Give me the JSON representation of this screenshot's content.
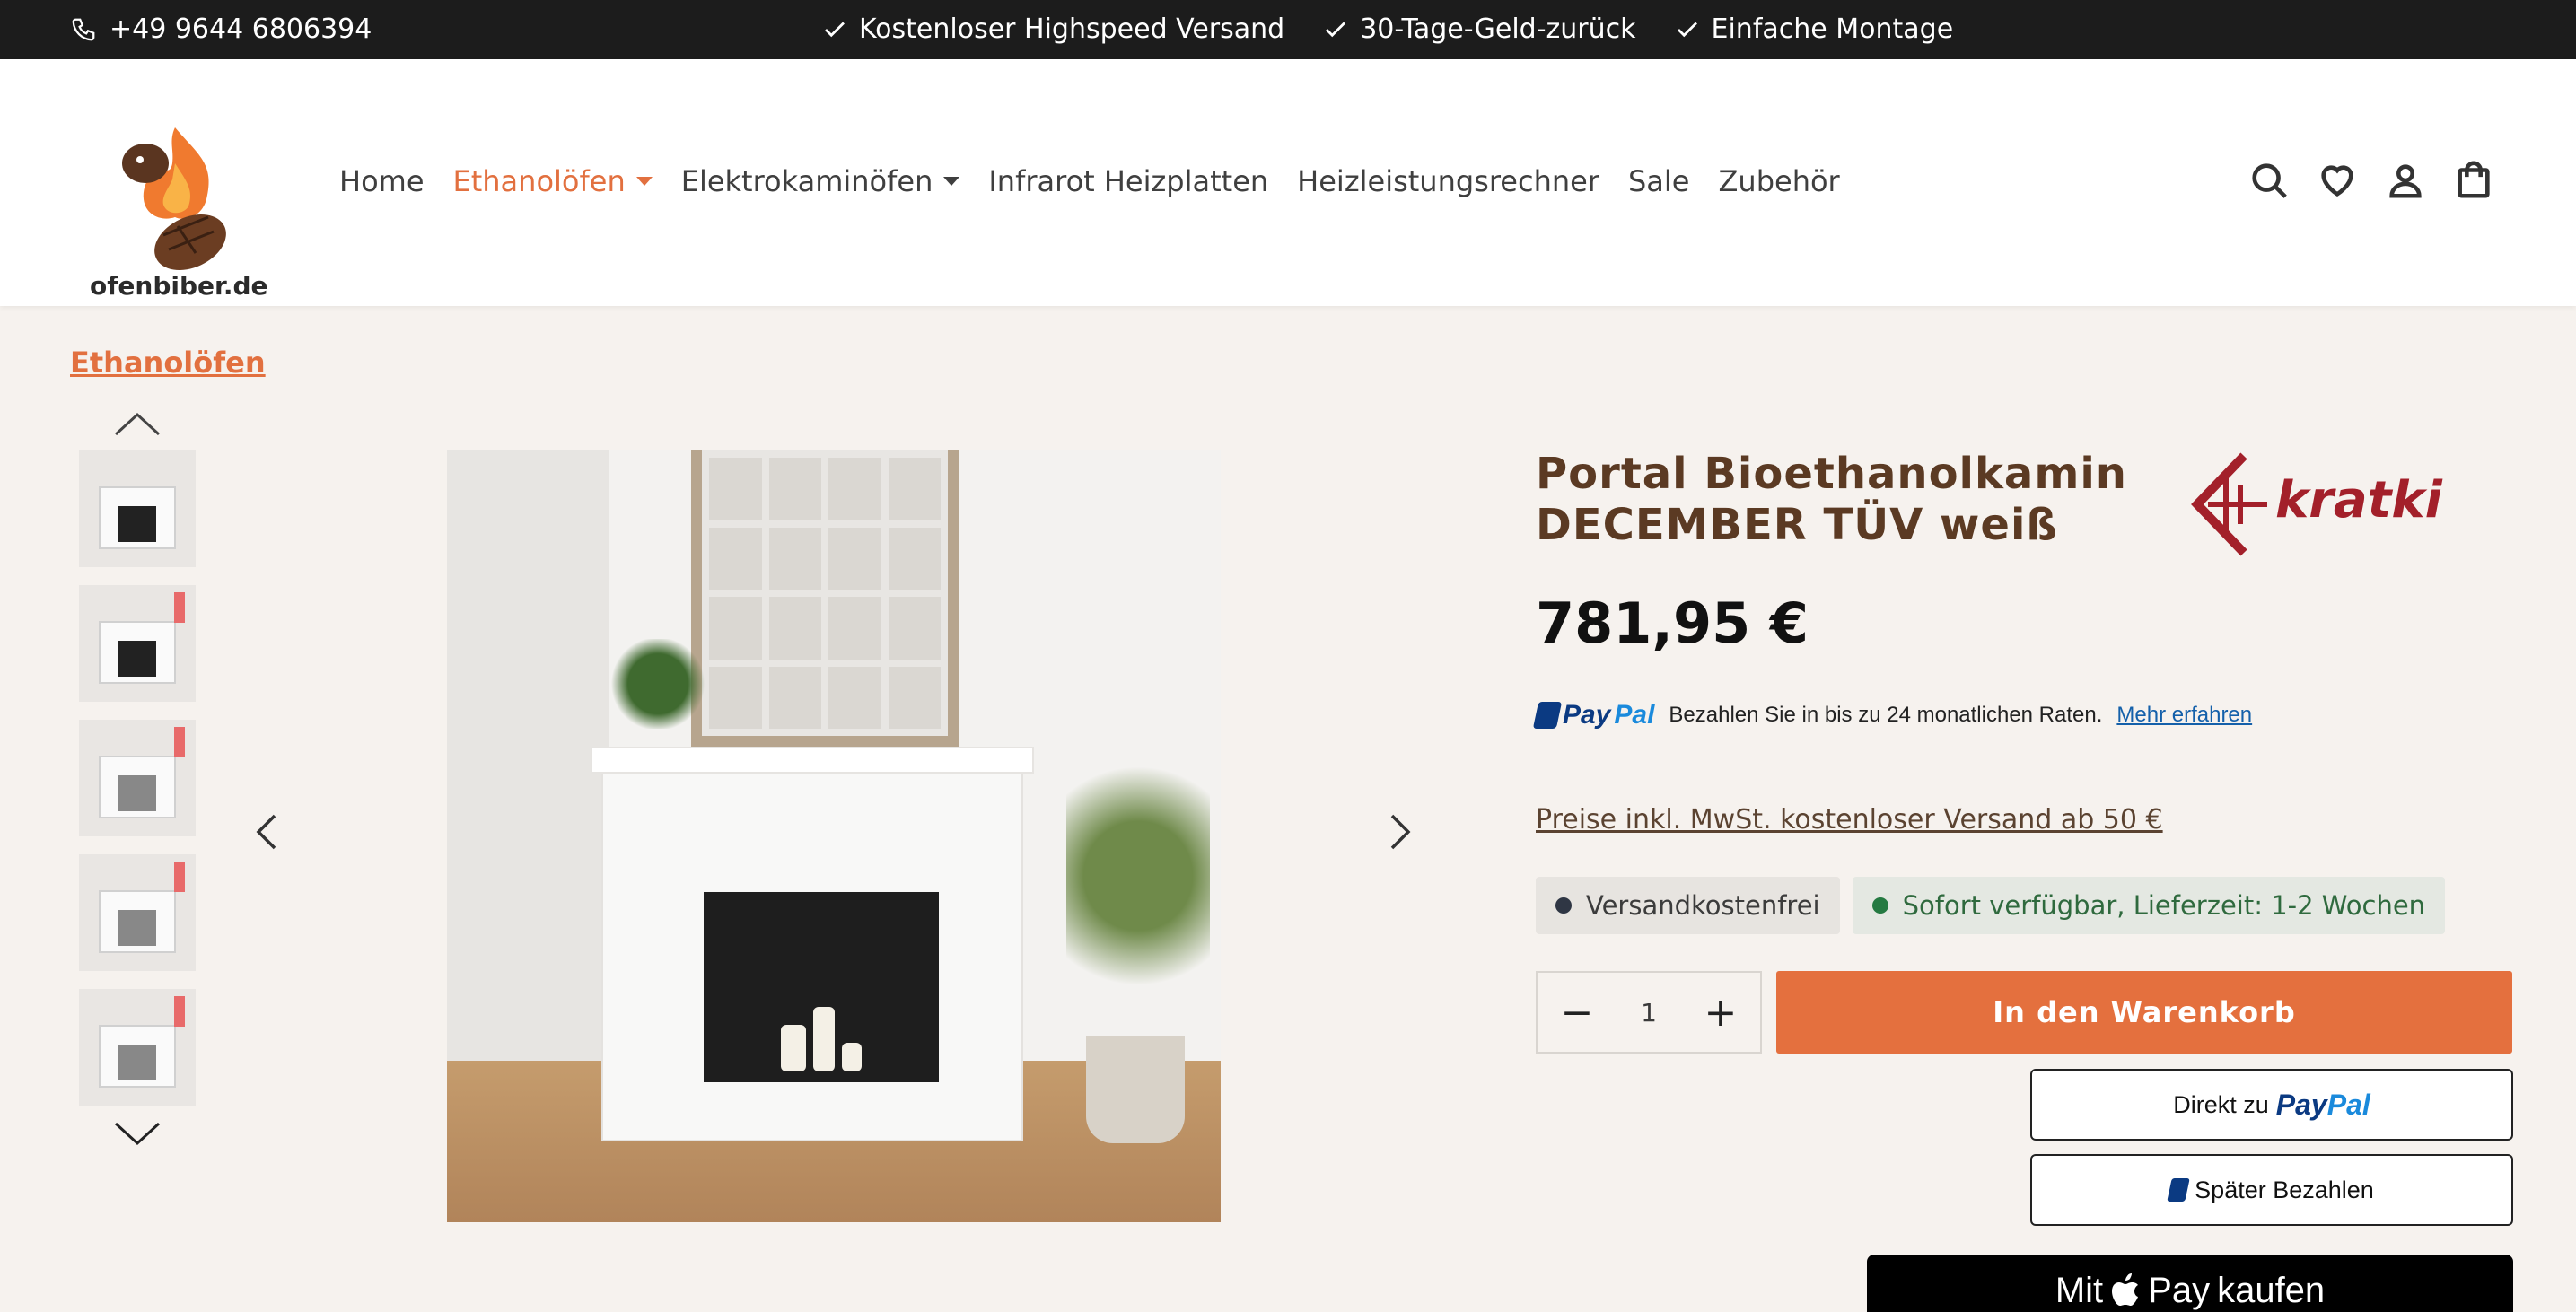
{
  "topbar": {
    "phone": "+49 9644 6806394",
    "usps": [
      "Kostenloser Highspeed Versand",
      "30-Tage-Geld-zurück",
      "Einfache Montage"
    ]
  },
  "header": {
    "logo_text": "ofenbiber.de",
    "nav": [
      {
        "label": "Home",
        "has_dropdown": false,
        "active": false
      },
      {
        "label": "Ethanolöfen",
        "has_dropdown": true,
        "active": true
      },
      {
        "label": "Elektrokaminöfen",
        "has_dropdown": true,
        "active": false
      },
      {
        "label": "Infrarot Heizplatten",
        "has_dropdown": false,
        "active": false
      },
      {
        "label": "Heizleistungsrechner",
        "has_dropdown": false,
        "active": false
      },
      {
        "label": "Sale",
        "has_dropdown": false,
        "active": false
      },
      {
        "label": "Zubehör",
        "has_dropdown": false,
        "active": false
      }
    ],
    "icons": [
      "search-icon",
      "wishlist-heart-icon",
      "account-icon",
      "cart-bag-icon"
    ]
  },
  "breadcrumb": "Ethanolöfen",
  "gallery": {
    "thumbnail_count": 5
  },
  "product": {
    "title": "Portal Bioethanolkamin DECEMBER TÜV weiß",
    "brand": "kratki",
    "price": "781,95 €",
    "paypal": {
      "logo_pay": "Pay",
      "logo_pal": "Pal",
      "text": "Bezahlen Sie in bis zu 24 monatlichen Raten.",
      "link": "Mehr erfahren"
    },
    "tax_note": "Preise inkl. MwSt. kostenloser Versand ab 50 €",
    "badges": [
      "Versandkostenfrei",
      "Sofort verfügbar, Lieferzeit: 1-2 Wochen"
    ],
    "quantity": "1",
    "add_to_cart": "In den Warenkorb",
    "paypal_direct_prefix": "Direkt zu",
    "paypal_word_pay": "Pay",
    "paypal_word_pal": "Pal",
    "paypal_later": "Später Bezahlen",
    "apple_pay_prefix": "Mit",
    "apple_pay_word": "Pay",
    "apple_pay_suffix": "kaufen"
  },
  "colors": {
    "accent": "#e4703e",
    "title_brown": "#5b3a23",
    "topbar": "#1c1c1c",
    "page_bg": "#f6f2ee"
  }
}
